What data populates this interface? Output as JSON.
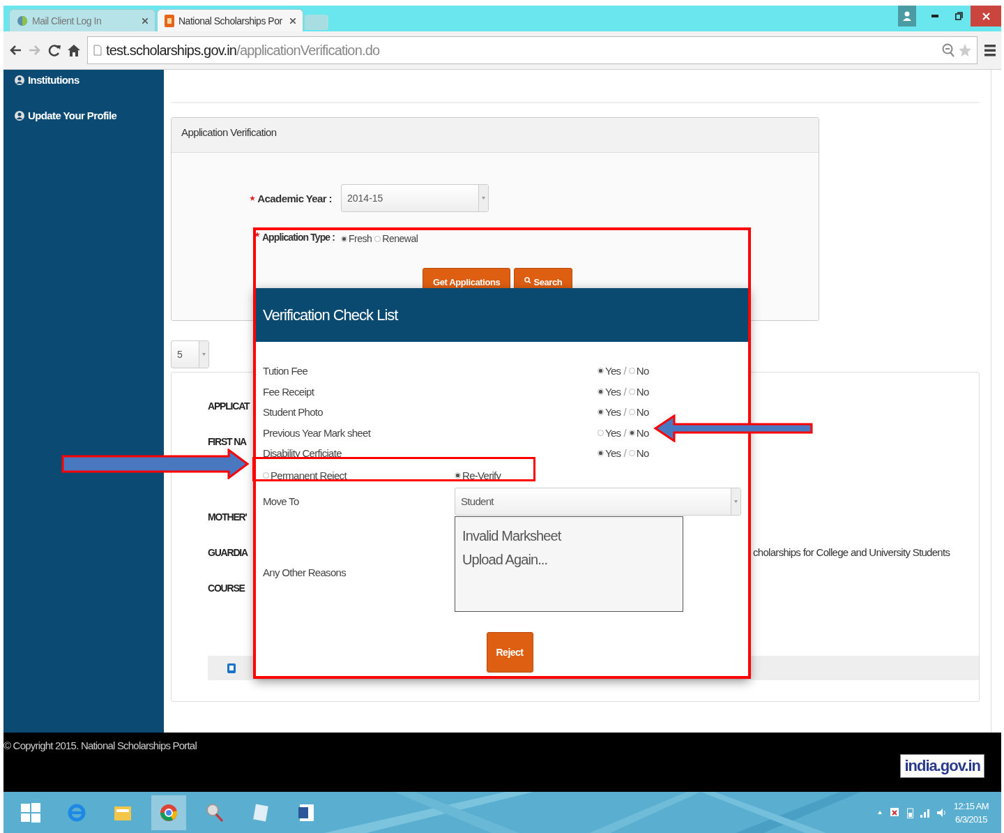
{
  "browser": {
    "tabs": [
      {
        "title": "Mail Client Log In",
        "selected": false
      },
      {
        "title": "National Scholarships Por",
        "selected": true
      }
    ],
    "url_host": "test.scholarships.gov.in",
    "url_path": "/applicationVerification.do"
  },
  "sidebar": {
    "items": [
      {
        "label": "Institutions"
      },
      {
        "label": "Update Your Profile"
      }
    ]
  },
  "verification_panel": {
    "title": "Application Verification",
    "academic_year": {
      "label": "Academic Year :",
      "value": "2014-15",
      "required": true
    },
    "application_type": {
      "label": "Application Type :",
      "required": true,
      "options": [
        {
          "label": "Fresh",
          "selected": true
        },
        {
          "label": "Renewal",
          "selected": false
        }
      ]
    },
    "buttons": [
      {
        "label": "Get Applications",
        "kind": "plain"
      },
      {
        "label": "Search",
        "kind": "search"
      }
    ]
  },
  "page_size": "5",
  "details": {
    "labels": [
      "APPLICAT",
      "FIRST NA",
      "MOTHER'",
      "GUARDIA",
      "COURSE"
    ],
    "scheme_text": "cholarships for College and University Students"
  },
  "modal": {
    "title": "Verification Check List",
    "checklist": [
      {
        "label": "Tution Fee",
        "separator": "/",
        "options": [
          {
            "label": "Yes",
            "selected": true
          },
          {
            "label": "No",
            "selected": false
          }
        ]
      },
      {
        "label": "Fee Receipt",
        "separator": "/",
        "options": [
          {
            "label": "Yes",
            "selected": true
          },
          {
            "label": "No",
            "selected": false
          }
        ]
      },
      {
        "label": "Student Photo",
        "separator": "/",
        "options": [
          {
            "label": "Yes",
            "selected": true
          },
          {
            "label": "No",
            "selected": false
          }
        ]
      },
      {
        "label": "Previous Year Mark sheet",
        "separator": "/",
        "options": [
          {
            "label": "Yes",
            "selected": false
          },
          {
            "label": "No",
            "selected": true
          }
        ]
      },
      {
        "label": "Disability Cerficiate",
        "separator": "/",
        "options": [
          {
            "label": "Yes",
            "selected": true
          },
          {
            "label": "No",
            "selected": false
          }
        ]
      }
    ],
    "decision": [
      {
        "label": "Permanent Reject",
        "selected": false
      },
      {
        "label": "Re-Verify",
        "selected": true
      }
    ],
    "move_to": {
      "label": "Move To",
      "value": "Student"
    },
    "other_reasons": {
      "label": "Any Other Reasons",
      "value": "Invalid Marksheet\nUpload Again..."
    },
    "button": "Reject"
  },
  "footer": {
    "copyright": "© Copyright 2015. National Scholarships Portal",
    "logo": "india.gov.in"
  },
  "taskbar": {
    "time": "12:15 AM",
    "date": "6/3/2015"
  }
}
